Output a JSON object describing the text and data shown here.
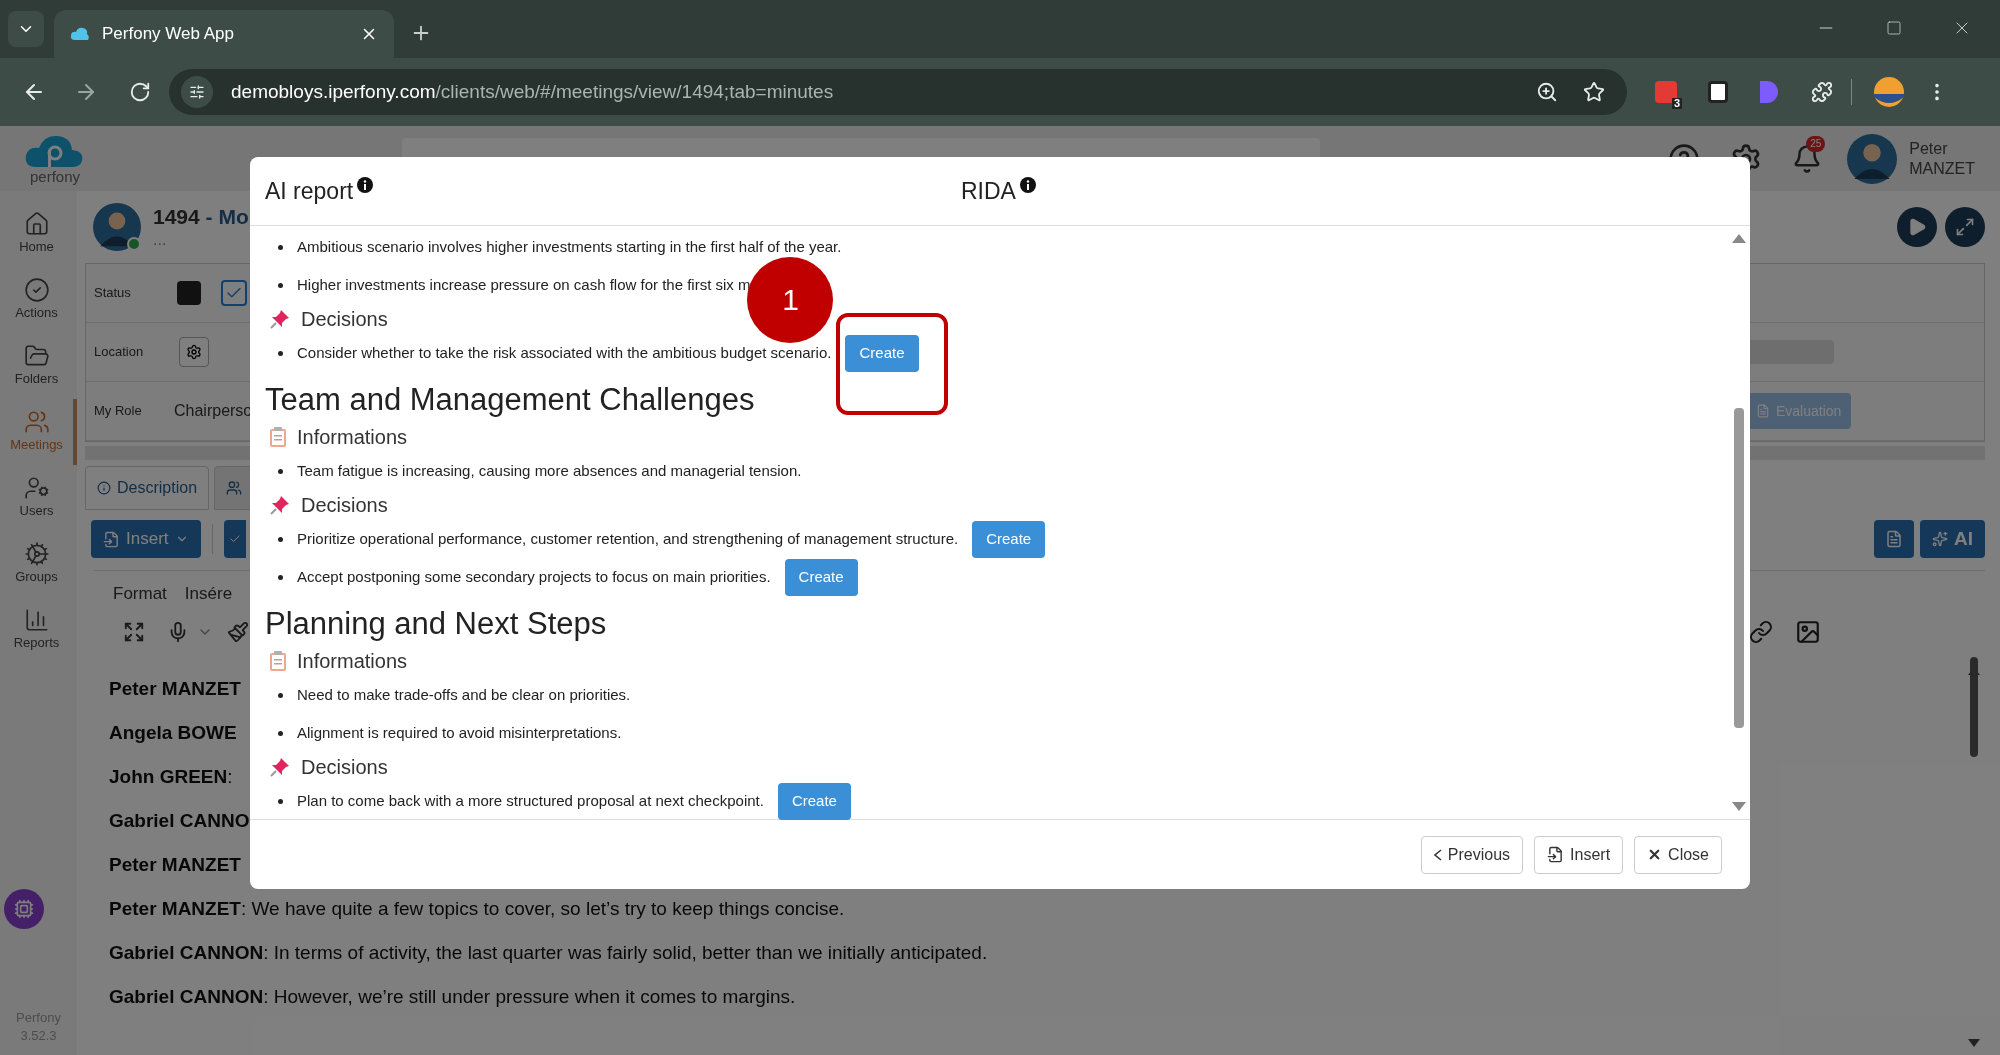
{
  "browser": {
    "tab_title": "Perfony Web App",
    "url_host": "demobloys.iperfony.com",
    "url_path": "/clients/web/#/meetings/view/1494;tab=minutes",
    "extension_badge": "3"
  },
  "header": {
    "logo_text": "perfony",
    "notification_count": "25",
    "user_first": "Peter",
    "user_last": "MANZET"
  },
  "sidebar": {
    "items": [
      {
        "label": "Home",
        "selected": false
      },
      {
        "label": "Actions",
        "selected": false
      },
      {
        "label": "Folders",
        "selected": false
      },
      {
        "label": "Meetings",
        "selected": true
      },
      {
        "label": "Users",
        "selected": false
      },
      {
        "label": "Groups",
        "selected": false
      },
      {
        "label": "Reports",
        "selected": false
      }
    ],
    "footer": [
      "Perfony",
      "3.52.3"
    ]
  },
  "meeting": {
    "number": "1494",
    "title": "- Mo",
    "subtitle": "...",
    "fields": [
      {
        "kind": "status",
        "label": "Status",
        "checked": true
      },
      {
        "kind": "location",
        "label": "Location"
      },
      {
        "kind": "role",
        "label": "My Role",
        "value": "Chairperso"
      }
    ],
    "evaluation_button": "Evaluation",
    "tabs": [
      {
        "label": "Description",
        "selected": true
      },
      {
        "selected": false
      }
    ],
    "insert_button": "Insert",
    "ai_button": "AI",
    "editor_menus": [
      "Format",
      "Insére"
    ],
    "transcript": [
      {
        "speaker": "Peter MANZET"
      },
      {
        "speaker": "Angela BOWE"
      },
      {
        "speaker": "John GREEN",
        "text": ":"
      },
      {
        "speaker": "Gabriel CANNO"
      },
      {
        "speaker": "Peter MANZET"
      },
      {
        "speaker": "Peter MANZET",
        "text": ": We have quite a few topics to cover, so let’s try to keep things concise."
      },
      {
        "speaker": "Gabriel CANNON",
        "text": ": In terms of activity, the last quarter was fairly solid, better than we initially anticipated."
      },
      {
        "speaker": "Gabriel CANNON",
        "text": ": However, we’re still under pressure when it comes to margins."
      }
    ]
  },
  "report": {
    "title": "AI report",
    "rida_title": "RIDA",
    "blocks": [
      {
        "kind": "item",
        "text": "Ambitious scenario involves higher investments starting in the first half of the year."
      },
      {
        "kind": "item",
        "text": "Higher investments increase pressure on cash flow for the first six m"
      },
      {
        "kind": "decisions",
        "label": "Decisions"
      },
      {
        "kind": "item",
        "text": "Consider whether to take the risk associated with the ambitious budget scenario.",
        "button": "Create",
        "annotation": "1"
      },
      {
        "kind": "heading",
        "text": "Team and Management Challenges"
      },
      {
        "kind": "informations",
        "label": "Informations"
      },
      {
        "kind": "item",
        "text": "Team fatigue is increasing, causing more absences and managerial tension."
      },
      {
        "kind": "decisions",
        "label": "Decisions"
      },
      {
        "kind": "item",
        "text": "Prioritize operational performance, customer retention, and strengthening of management structure.",
        "button": "Create"
      },
      {
        "kind": "item",
        "text": "Accept postponing some secondary projects to focus on main priorities.",
        "button": "Create"
      },
      {
        "kind": "heading",
        "text": "Planning and Next Steps"
      },
      {
        "kind": "informations",
        "label": "Informations"
      },
      {
        "kind": "item",
        "text": "Need to make trade-offs and be clear on priorities."
      },
      {
        "kind": "item",
        "text": "Alignment is required to avoid misinterpretations."
      },
      {
        "kind": "decisions",
        "label": "Decisions"
      },
      {
        "kind": "item",
        "text": "Plan to come back with a more structured proposal at next checkpoint.",
        "button": "Create"
      }
    ],
    "footer_buttons": [
      {
        "label": "Previous"
      },
      {
        "label": "Insert"
      },
      {
        "label": "Close"
      }
    ]
  }
}
